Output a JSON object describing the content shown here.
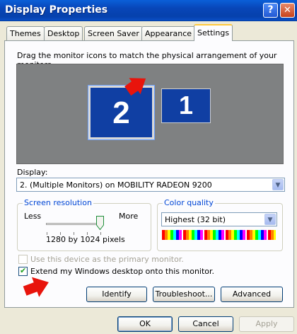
{
  "window": {
    "title": "Display Properties",
    "help_glyph": "?",
    "close_glyph": "✕"
  },
  "tabs": [
    {
      "label": "Themes",
      "active": false
    },
    {
      "label": "Desktop",
      "active": false
    },
    {
      "label": "Screen Saver",
      "active": false
    },
    {
      "label": "Appearance",
      "active": false
    },
    {
      "label": "Settings",
      "active": true
    }
  ],
  "arrange": {
    "instruction": "Drag the monitor icons to match the physical arrangement of your monitors.",
    "monitors": [
      {
        "number": "2",
        "selected": true
      },
      {
        "number": "1",
        "selected": false
      }
    ]
  },
  "display": {
    "label": "Display:",
    "value": "2. (Multiple Monitors) on MOBILITY RADEON 9200"
  },
  "resolution": {
    "group_title": "Screen resolution",
    "less_label": "Less",
    "more_label": "More",
    "value_text": "1280 by 1024 pixels",
    "slider_level": 1.0
  },
  "color_quality": {
    "group_title": "Color quality",
    "value": "Highest (32 bit)"
  },
  "options": {
    "primary_label": "Use this device as the primary monitor.",
    "primary_checked": false,
    "primary_enabled": false,
    "extend_label": "Extend my Windows desktop onto this monitor.",
    "extend_checked": true
  },
  "buttons": {
    "identify": "Identify",
    "troubleshoot": "Troubleshoot...",
    "advanced": "Advanced",
    "ok": "OK",
    "cancel": "Cancel",
    "apply": "Apply"
  },
  "colors": {
    "title_bar": "#0a5fd8",
    "monitor_fill": "#103fa3",
    "arrow": "#e8140c",
    "group_title": "#0046d5"
  }
}
